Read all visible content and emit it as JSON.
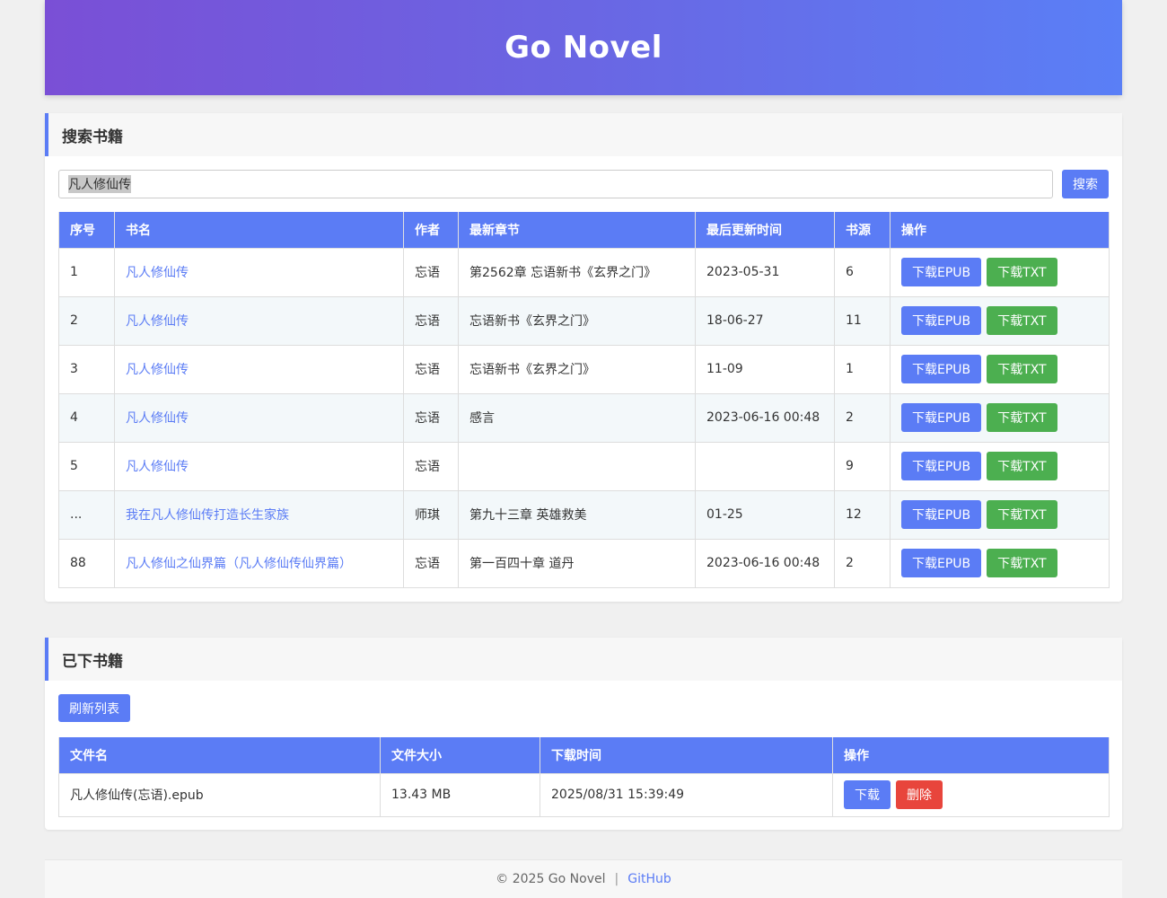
{
  "header": {
    "title": "Go Novel"
  },
  "search": {
    "section_title": "搜索书籍",
    "input_value": "凡人修仙传",
    "button_label": "搜索",
    "columns": [
      "序号",
      "书名",
      "作者",
      "最新章节",
      "最后更新时间",
      "书源",
      "操作"
    ],
    "rows": [
      {
        "index": "1",
        "title": "凡人修仙传",
        "author": "忘语",
        "latest": "第2562章 忘语新书《玄界之门》",
        "updated": "2023-05-31",
        "source": "6"
      },
      {
        "index": "2",
        "title": "凡人修仙传",
        "author": "忘语",
        "latest": "忘语新书《玄界之门》",
        "updated": "18-06-27",
        "source": "11"
      },
      {
        "index": "3",
        "title": "凡人修仙传",
        "author": "忘语",
        "latest": "忘语新书《玄界之门》",
        "updated": "11-09",
        "source": "1"
      },
      {
        "index": "4",
        "title": "凡人修仙传",
        "author": "忘语",
        "latest": "感言",
        "updated": "2023-06-16 00:48",
        "source": "2"
      },
      {
        "index": "5",
        "title": "凡人修仙传",
        "author": "忘语",
        "latest": "",
        "updated": "",
        "source": "9"
      },
      {
        "index": "...",
        "title": "我在凡人修仙传打造长生家族",
        "author": "师琪",
        "latest": "第九十三章 英雄救美",
        "updated": "01-25",
        "source": "12"
      },
      {
        "index": "88",
        "title": "凡人修仙之仙界篇（凡人修仙传仙界篇）",
        "author": "忘语",
        "latest": "第一百四十章 道丹",
        "updated": "2023-06-16 00:48",
        "source": "2"
      }
    ],
    "epub_label": "下载EPUB",
    "txt_label": "下载TXT"
  },
  "downloads": {
    "section_title": "已下书籍",
    "refresh_label": "刷新列表",
    "columns": [
      "文件名",
      "文件大小",
      "下载时间",
      "操作"
    ],
    "rows": [
      {
        "filename": "凡人修仙传(忘语).epub",
        "size": "13.43 MB",
        "time": "2025/08/31 15:39:49"
      }
    ],
    "download_label": "下载",
    "delete_label": "删除"
  },
  "footer": {
    "copyright": "© 2025 Go Novel",
    "separator": "|",
    "link": "GitHub"
  },
  "colors": {
    "primary": "#5b7cf5",
    "success": "#4caf50",
    "danger": "#e8453c"
  }
}
